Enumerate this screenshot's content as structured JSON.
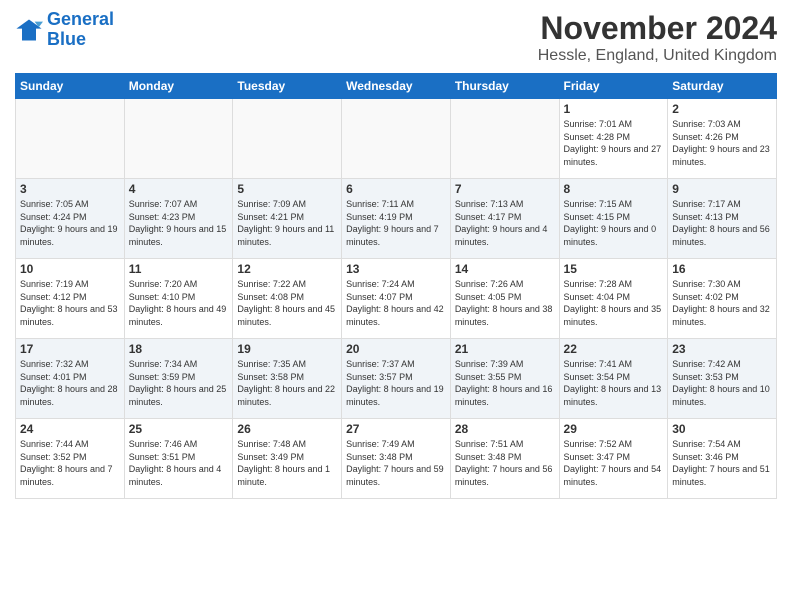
{
  "header": {
    "logo_line1": "General",
    "logo_line2": "Blue",
    "title": "November 2024",
    "subtitle": "Hessle, England, United Kingdom"
  },
  "days_of_week": [
    "Sunday",
    "Monday",
    "Tuesday",
    "Wednesday",
    "Thursday",
    "Friday",
    "Saturday"
  ],
  "weeks": [
    [
      {
        "day": "",
        "info": ""
      },
      {
        "day": "",
        "info": ""
      },
      {
        "day": "",
        "info": ""
      },
      {
        "day": "",
        "info": ""
      },
      {
        "day": "",
        "info": ""
      },
      {
        "day": "1",
        "info": "Sunrise: 7:01 AM\nSunset: 4:28 PM\nDaylight: 9 hours and 27 minutes."
      },
      {
        "day": "2",
        "info": "Sunrise: 7:03 AM\nSunset: 4:26 PM\nDaylight: 9 hours and 23 minutes."
      }
    ],
    [
      {
        "day": "3",
        "info": "Sunrise: 7:05 AM\nSunset: 4:24 PM\nDaylight: 9 hours and 19 minutes."
      },
      {
        "day": "4",
        "info": "Sunrise: 7:07 AM\nSunset: 4:23 PM\nDaylight: 9 hours and 15 minutes."
      },
      {
        "day": "5",
        "info": "Sunrise: 7:09 AM\nSunset: 4:21 PM\nDaylight: 9 hours and 11 minutes."
      },
      {
        "day": "6",
        "info": "Sunrise: 7:11 AM\nSunset: 4:19 PM\nDaylight: 9 hours and 7 minutes."
      },
      {
        "day": "7",
        "info": "Sunrise: 7:13 AM\nSunset: 4:17 PM\nDaylight: 9 hours and 4 minutes."
      },
      {
        "day": "8",
        "info": "Sunrise: 7:15 AM\nSunset: 4:15 PM\nDaylight: 9 hours and 0 minutes."
      },
      {
        "day": "9",
        "info": "Sunrise: 7:17 AM\nSunset: 4:13 PM\nDaylight: 8 hours and 56 minutes."
      }
    ],
    [
      {
        "day": "10",
        "info": "Sunrise: 7:19 AM\nSunset: 4:12 PM\nDaylight: 8 hours and 53 minutes."
      },
      {
        "day": "11",
        "info": "Sunrise: 7:20 AM\nSunset: 4:10 PM\nDaylight: 8 hours and 49 minutes."
      },
      {
        "day": "12",
        "info": "Sunrise: 7:22 AM\nSunset: 4:08 PM\nDaylight: 8 hours and 45 minutes."
      },
      {
        "day": "13",
        "info": "Sunrise: 7:24 AM\nSunset: 4:07 PM\nDaylight: 8 hours and 42 minutes."
      },
      {
        "day": "14",
        "info": "Sunrise: 7:26 AM\nSunset: 4:05 PM\nDaylight: 8 hours and 38 minutes."
      },
      {
        "day": "15",
        "info": "Sunrise: 7:28 AM\nSunset: 4:04 PM\nDaylight: 8 hours and 35 minutes."
      },
      {
        "day": "16",
        "info": "Sunrise: 7:30 AM\nSunset: 4:02 PM\nDaylight: 8 hours and 32 minutes."
      }
    ],
    [
      {
        "day": "17",
        "info": "Sunrise: 7:32 AM\nSunset: 4:01 PM\nDaylight: 8 hours and 28 minutes."
      },
      {
        "day": "18",
        "info": "Sunrise: 7:34 AM\nSunset: 3:59 PM\nDaylight: 8 hours and 25 minutes."
      },
      {
        "day": "19",
        "info": "Sunrise: 7:35 AM\nSunset: 3:58 PM\nDaylight: 8 hours and 22 minutes."
      },
      {
        "day": "20",
        "info": "Sunrise: 7:37 AM\nSunset: 3:57 PM\nDaylight: 8 hours and 19 minutes."
      },
      {
        "day": "21",
        "info": "Sunrise: 7:39 AM\nSunset: 3:55 PM\nDaylight: 8 hours and 16 minutes."
      },
      {
        "day": "22",
        "info": "Sunrise: 7:41 AM\nSunset: 3:54 PM\nDaylight: 8 hours and 13 minutes."
      },
      {
        "day": "23",
        "info": "Sunrise: 7:42 AM\nSunset: 3:53 PM\nDaylight: 8 hours and 10 minutes."
      }
    ],
    [
      {
        "day": "24",
        "info": "Sunrise: 7:44 AM\nSunset: 3:52 PM\nDaylight: 8 hours and 7 minutes."
      },
      {
        "day": "25",
        "info": "Sunrise: 7:46 AM\nSunset: 3:51 PM\nDaylight: 8 hours and 4 minutes."
      },
      {
        "day": "26",
        "info": "Sunrise: 7:48 AM\nSunset: 3:49 PM\nDaylight: 8 hours and 1 minute."
      },
      {
        "day": "27",
        "info": "Sunrise: 7:49 AM\nSunset: 3:48 PM\nDaylight: 7 hours and 59 minutes."
      },
      {
        "day": "28",
        "info": "Sunrise: 7:51 AM\nSunset: 3:48 PM\nDaylight: 7 hours and 56 minutes."
      },
      {
        "day": "29",
        "info": "Sunrise: 7:52 AM\nSunset: 3:47 PM\nDaylight: 7 hours and 54 minutes."
      },
      {
        "day": "30",
        "info": "Sunrise: 7:54 AM\nSunset: 3:46 PM\nDaylight: 7 hours and 51 minutes."
      }
    ]
  ]
}
